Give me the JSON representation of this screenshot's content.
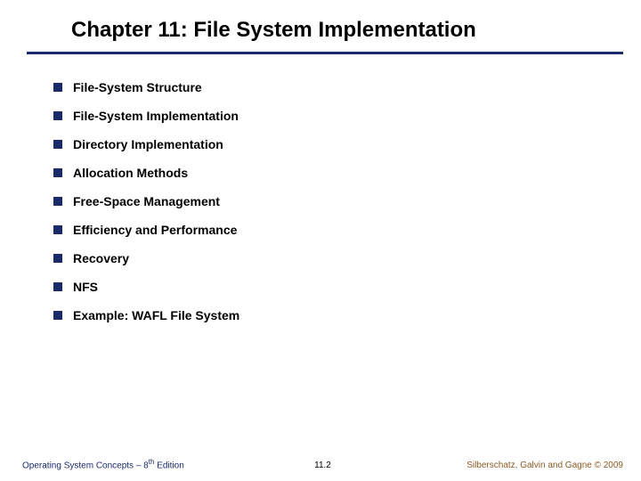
{
  "title": "Chapter 11: File System Implementation",
  "items": [
    "File-System Structure",
    "File-System Implementation",
    "Directory Implementation",
    "Allocation Methods",
    "Free-Space Management",
    "Efficiency and Performance",
    "Recovery",
    "NFS",
    "Example: WAFL File System"
  ],
  "footer": {
    "left_prefix": "Operating System Concepts – 8",
    "left_suffix": " Edition",
    "left_sup": "th",
    "center": "11.2",
    "right": "Silberschatz, Galvin and Gagne © 2009"
  }
}
